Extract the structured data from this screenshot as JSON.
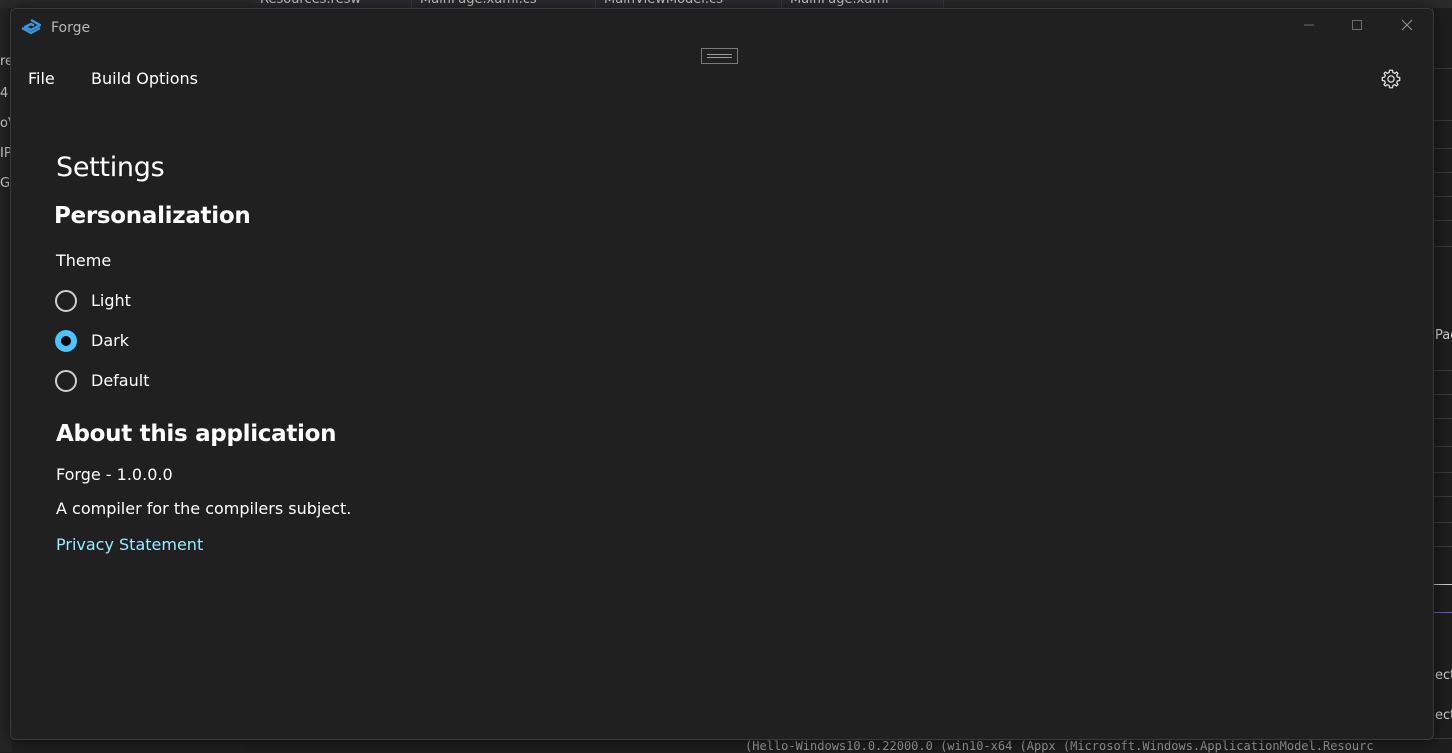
{
  "background_ide": {
    "tabs": [
      "Resources.resw",
      "MainPage.xaml.cs",
      "MainViewModel.cs",
      "MainPage.xaml"
    ],
    "left_fragments": [
      "re",
      "4",
      "oV",
      "IP",
      "Gr"
    ],
    "right_fragments": [
      "Pag",
      "ect",
      "ect"
    ],
    "bottom_output": "(Hello-Windows10.0.22000.0 (win10-x64 (Appx (Microsoft.Windows.ApplicationModel.Resourc"
  },
  "window": {
    "title": "Forge",
    "logo_color": "#3a96dd"
  },
  "menu": {
    "file": "File",
    "build_options": "Build Options"
  },
  "settings": {
    "page_title": "Settings",
    "personalization_heading": "Personalization",
    "theme_label": "Theme",
    "theme_options": [
      {
        "label": "Light",
        "checked": false
      },
      {
        "label": "Dark",
        "checked": true
      },
      {
        "label": "Default",
        "checked": false
      }
    ],
    "accent_color": "#4cc2ff",
    "about_heading": "About this application",
    "version_text": "Forge - 1.0.0.0",
    "description": "A compiler for the compilers subject.",
    "privacy_link": "Privacy Statement",
    "link_color": "#99ebff"
  }
}
